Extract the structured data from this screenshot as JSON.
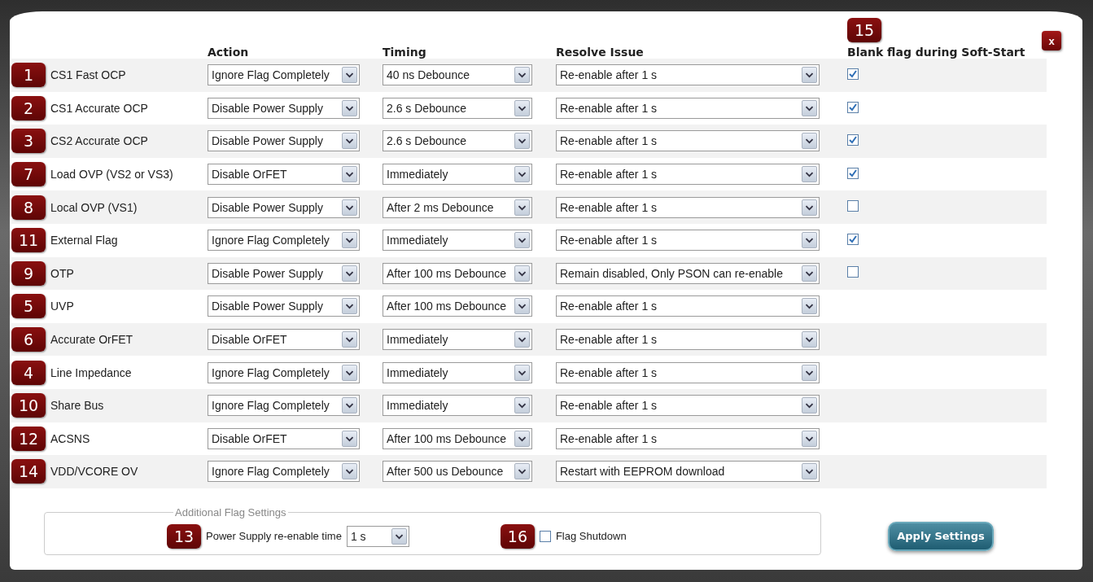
{
  "columns": {
    "action": "Action",
    "timing": "Timing",
    "resolve": "Resolve Issue",
    "blank_flag": "Blank flag during Soft-Start",
    "blank_flag_badge": "15"
  },
  "close_button": "x",
  "rows": [
    {
      "badge": "1",
      "label": "CS1 Fast OCP",
      "action": "Ignore Flag Completely",
      "timing": "40 ns Debounce",
      "resolve": "Re-enable after 1 s",
      "blank_flag": {
        "checked": true
      }
    },
    {
      "badge": "2",
      "label": "CS1 Accurate OCP",
      "action": "Disable Power Supply",
      "timing": "2.6 s Debounce",
      "resolve": "Re-enable after 1 s",
      "blank_flag": {
        "checked": true
      }
    },
    {
      "badge": "3",
      "label": "CS2 Accurate OCP",
      "action": "Disable Power Supply",
      "timing": "2.6 s Debounce",
      "resolve": "Re-enable after 1 s",
      "blank_flag": {
        "checked": true
      }
    },
    {
      "badge": "7",
      "label": "Load OVP (VS2 or VS3)",
      "action": "Disable OrFET",
      "timing": "Immediately",
      "resolve": "Re-enable after 1 s",
      "blank_flag": {
        "checked": true
      }
    },
    {
      "badge": "8",
      "label": "Local OVP (VS1)",
      "action": "Disable Power Supply",
      "timing": "After 2 ms Debounce",
      "resolve": "Re-enable after 1 s",
      "blank_flag": {
        "checked": false
      }
    },
    {
      "badge": "11",
      "label": "External Flag",
      "action": "Ignore Flag Completely",
      "timing": "Immediately",
      "resolve": "Re-enable after 1 s",
      "blank_flag": {
        "checked": true
      }
    },
    {
      "badge": "9",
      "label": "OTP",
      "action": "Disable Power Supply",
      "timing": "After 100 ms Debounce",
      "resolve": "Remain disabled, Only PSON can re-enable",
      "blank_flag": {
        "checked": false
      }
    },
    {
      "badge": "5",
      "label": "UVP",
      "action": "Disable Power Supply",
      "timing": "After 100 ms Debounce",
      "resolve": "Re-enable after 1 s"
    },
    {
      "badge": "6",
      "label": "Accurate OrFET",
      "action": "Disable OrFET",
      "timing": "Immediately",
      "resolve": "Re-enable after 1 s"
    },
    {
      "badge": "4",
      "label": "Line Impedance",
      "action": "Ignore Flag Completely",
      "timing": "Immediately",
      "resolve": "Re-enable after 1 s"
    },
    {
      "badge": "10",
      "label": "Share Bus",
      "action": "Ignore Flag Completely",
      "timing": "Immediately",
      "resolve": "Re-enable after 1 s"
    },
    {
      "badge": "12",
      "label": "ACSNS",
      "action": "Disable OrFET",
      "timing": "After 100 ms Debounce",
      "resolve": "Re-enable after 1 s"
    },
    {
      "badge": "14",
      "label": "VDD/VCORE OV",
      "action": "Ignore Flag Completely",
      "timing": "After 500 us Debounce",
      "resolve": "Restart with EEPROM download"
    }
  ],
  "additional": {
    "legend": "Additional Flag Settings",
    "reenable_badge": "13",
    "reenable_label": "Power Supply re-enable time",
    "reenable_value": "1 s",
    "shutdown_badge": "16",
    "shutdown_label": "Flag Shutdown",
    "shutdown_checked": false
  },
  "apply_button": "Apply Settings"
}
